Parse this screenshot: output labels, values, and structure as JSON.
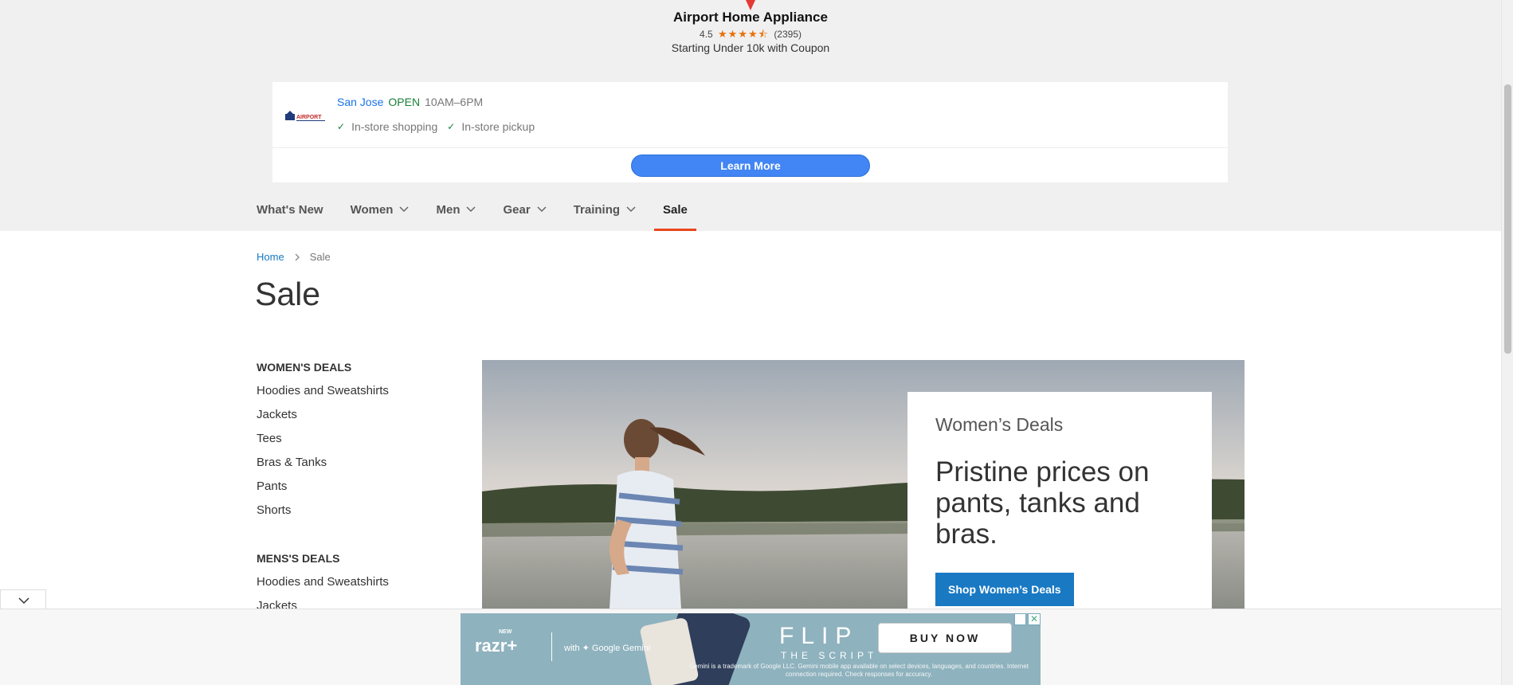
{
  "ad_top": {
    "business_name": "Airport Home Appliance",
    "rating": "4.5",
    "reviews": "(2395)",
    "tagline": "Starting Under 10k with Coupon",
    "store_city": "San Jose",
    "store_status": "OPEN",
    "store_hours": "10AM–6PM",
    "feature_1": "In-store shopping",
    "feature_2": "In-store pickup",
    "learn_more": "Learn More"
  },
  "nav": {
    "items": [
      {
        "label": "What's New"
      },
      {
        "label": "Women"
      },
      {
        "label": "Men"
      },
      {
        "label": "Gear"
      },
      {
        "label": "Training"
      },
      {
        "label": "Sale"
      }
    ]
  },
  "breadcrumb": {
    "home": "Home",
    "current": "Sale"
  },
  "page_title": "Sale",
  "sidebar": {
    "womens_heading": "WOMEN'S DEALS",
    "womens_items": [
      "Hoodies and Sweatshirts",
      "Jackets",
      "Tees",
      "Bras & Tanks",
      "Pants",
      "Shorts"
    ],
    "mens_heading": "MENS'S DEALS",
    "mens_items": [
      "Hoodies and Sweatshirts",
      "Jackets"
    ]
  },
  "hero": {
    "eyebrow": "Women’s Deals",
    "headline": "Pristine prices on pants, tanks and bras.",
    "cta": "Shop Women’s Deals"
  },
  "ad_bottom": {
    "new_label": "NEW",
    "brand": "razr+",
    "gemini": "with ✦ Google Gemini",
    "flip": "FLIP",
    "script": "THE SCRIPT",
    "buy_now": "BUY NOW",
    "fine_print": "Gemini is a trademark of Google LLC. Gemini mobile app available on select devices, languages, and countries. Internet connection required. Check responses for accuracy."
  },
  "colors": {
    "link_blue": "#1979c3",
    "ad_blue": "#4285f4",
    "open_green": "#188038",
    "active_underline": "#e8471c"
  }
}
